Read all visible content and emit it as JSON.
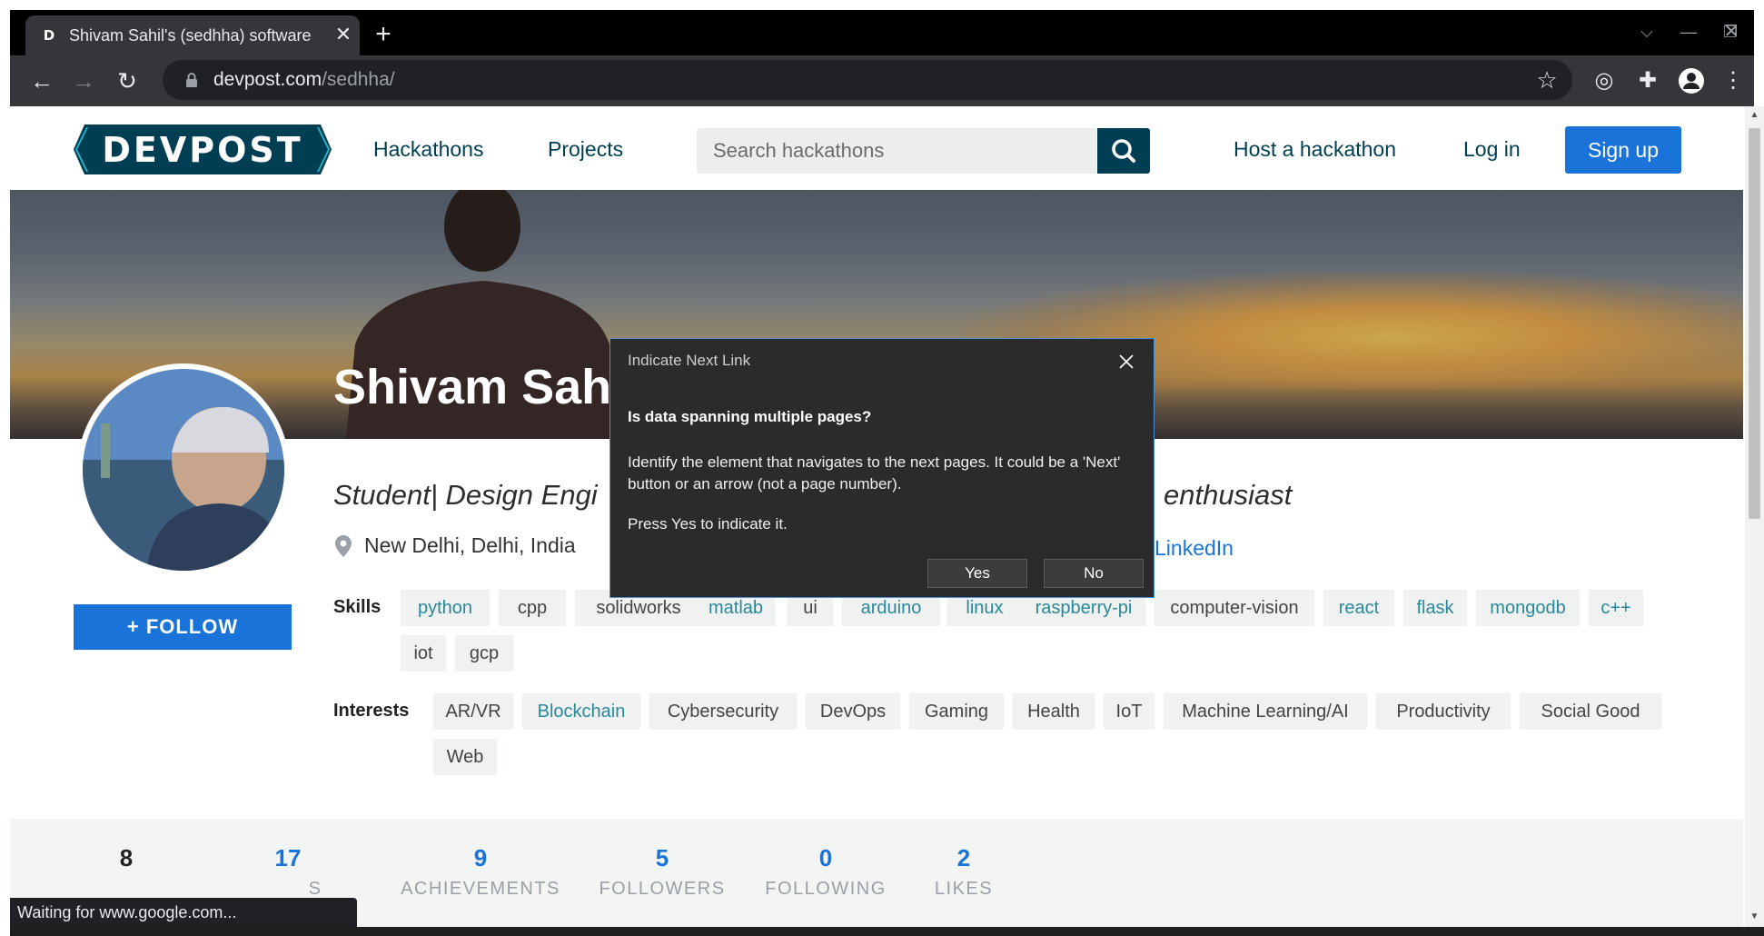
{
  "browser": {
    "tab": {
      "favicon": "D",
      "title": "Shivam Sahil's (sedhha) software"
    },
    "new_tab": "+",
    "url": {
      "host": "devpost.com",
      "path": "/sedhha/"
    },
    "status_text": "Waiting for www.google.com..."
  },
  "header": {
    "logo_text": "DEVPOST",
    "nav": [
      "Hackathons",
      "Projects"
    ],
    "search_placeholder": "Search hackathons",
    "host_link": "Host a hackathon",
    "login_link": "Log in",
    "signup_button": "Sign up"
  },
  "profile": {
    "name": "Shivam Sahil",
    "follow_button": "+ FOLLOW",
    "tagline_start": "Student| Design Engi",
    "tagline_end": "enthusiast",
    "location": "New Delhi, Delhi, India",
    "linkedin": "LinkedIn",
    "skills_label": "Skills",
    "skills": [
      "python",
      "cpp",
      "solidworks",
      "matlab",
      "ui",
      "arduino",
      "linux",
      "raspberry-pi",
      "computer-vision",
      "react",
      "flask",
      "mongodb",
      "c++",
      "iot",
      "gcp"
    ],
    "interests_label": "Interests",
    "interests": [
      "AR/VR",
      "Blockchain",
      "Cybersecurity",
      "DevOps",
      "Gaming",
      "Health",
      "IoT",
      "Machine Learning/AI",
      "Productivity",
      "Social Good",
      "Web"
    ]
  },
  "stats": [
    {
      "value": "8",
      "label": ""
    },
    {
      "value": "17",
      "label": "S"
    },
    {
      "value": "9",
      "label": "ACHIEVEMENTS"
    },
    {
      "value": "5",
      "label": "FOLLOWERS"
    },
    {
      "value": "0",
      "label": "FOLLOWING"
    },
    {
      "value": "2",
      "label": "LIKES"
    }
  ],
  "dialog": {
    "title": "Indicate Next Link",
    "question": "Is data spanning multiple pages?",
    "body": "Identify the element that navigates to the next pages. It could be a 'Next' button or an arrow (not a page number).",
    "press": "Press Yes to indicate it.",
    "yes": "Yes",
    "no": "No"
  },
  "colors": {
    "devpost_navy": "#003e54",
    "devpost_teal": "#29889a",
    "primary_blue": "#1a73d9"
  }
}
